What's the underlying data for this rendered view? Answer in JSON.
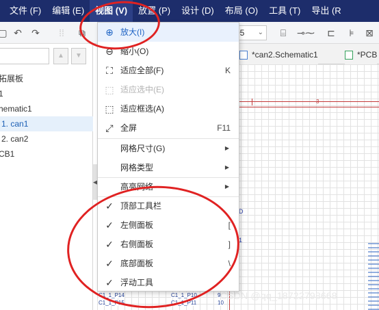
{
  "menubar": {
    "items": [
      {
        "label": "文件 (F)"
      },
      {
        "label": "编辑 (E)"
      },
      {
        "label": "视图 (V)"
      },
      {
        "label": "放置 (P)"
      },
      {
        "label": "设计 (D)"
      },
      {
        "label": "布局 (O)"
      },
      {
        "label": "工具 (T)"
      },
      {
        "label": "导出 (R"
      }
    ],
    "active_index": 2
  },
  "toolbar": {
    "zoom_value": "05",
    "zoom_caret": "⌄"
  },
  "left_panel": {
    "tree": [
      {
        "label": "拓展板"
      },
      {
        "label": "1"
      },
      {
        "label": "hematic1"
      },
      {
        "label": "1. can1",
        "selected": true
      },
      {
        "label": "2. can2"
      },
      {
        "label": "CB1"
      }
    ]
  },
  "tabs": [
    {
      "label": "*can2.Schematic1"
    },
    {
      "label": "*PCB"
    }
  ],
  "view_menu": {
    "items": [
      {
        "label": "放大(I)",
        "icon": "zoom-in-icon",
        "glyph": "⊕",
        "state": "hover"
      },
      {
        "label": "缩小(O)",
        "icon": "zoom-out-icon",
        "glyph": "⊖"
      },
      {
        "label": "适应全部(F)",
        "icon": "fit-all-icon",
        "glyph": "⛶",
        "shortcut": "K"
      },
      {
        "label": "适应选中(E)",
        "icon": "fit-selected-icon",
        "glyph": "⬚",
        "state": "disabled"
      },
      {
        "label": "适应框选(A)",
        "icon": "fit-box-icon",
        "glyph": "⬚"
      },
      {
        "label": "全屏",
        "icon": "fullscreen-icon",
        "glyph": "⤢",
        "shortcut": "F11"
      },
      {
        "label": "网格尺寸(G)",
        "submenu": true
      },
      {
        "label": "网格类型",
        "submenu": true
      },
      {
        "label": "高亮网络",
        "submenu": true
      },
      {
        "label": "顶部工具栏",
        "checked": true
      },
      {
        "label": "左侧面板",
        "checked": true,
        "shortcut": "["
      },
      {
        "label": "右侧面板",
        "checked": true,
        "shortcut": "]"
      },
      {
        "label": "底部面板",
        "checked": true,
        "shortcut": "\\"
      },
      {
        "label": "浮动工具",
        "checked": true
      }
    ],
    "submenu_arrow": "▶",
    "check_glyph": "✓"
  },
  "canvas": {
    "marker_number": "3",
    "fragment_1": "D",
    "fragment_2": "1",
    "bottom_rows": [
      "C1_1_P14",
      "C1_1_P10",
      "C1_1_P15",
      "C1_1_P11"
    ],
    "bottom_nums": [
      "9",
      "10"
    ]
  },
  "watermark": "CSDN @qq_18722798668",
  "colors": {
    "menubar_bg": "#1d2d6b",
    "hover_blue": "#1e63c4",
    "annotation_red": "#e02222",
    "schematic_red": "#c23a3a"
  }
}
